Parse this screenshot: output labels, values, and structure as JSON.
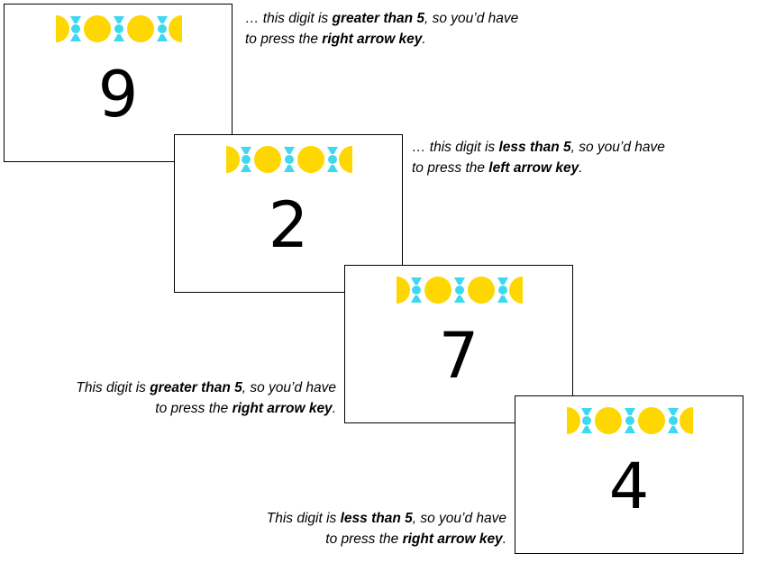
{
  "colors": {
    "yellow": "#FFD700",
    "cyan": "#3ED8F0",
    "border": "#000000"
  },
  "cards": [
    {
      "digit": "9"
    },
    {
      "digit": "2"
    },
    {
      "digit": "7"
    },
    {
      "digit": "4"
    }
  ],
  "captions": [
    {
      "l1_pre": "… this digit is ",
      "l1_bold": "greater than 5",
      "l1_post": ", so you’d have",
      "l2_pre": "to press the ",
      "l2_bold": "right arrow key",
      "l2_post": "."
    },
    {
      "l1_pre": "… this digit is ",
      "l1_bold": "less than 5",
      "l1_post": ", so you’d have",
      "l2_pre": "to press the ",
      "l2_bold": "left arrow key",
      "l2_post": "."
    },
    {
      "l1_pre": "This digit is ",
      "l1_bold": "greater than 5",
      "l1_post": ", so you’d have",
      "l2_pre": "to press the ",
      "l2_bold": "right arrow key",
      "l2_post": "."
    },
    {
      "l1_pre": "This digit is ",
      "l1_bold": "less than 5",
      "l1_post": ", so you’d have",
      "l2_pre": "to press the ",
      "l2_bold": "right arrow key",
      "l2_post": "."
    }
  ]
}
